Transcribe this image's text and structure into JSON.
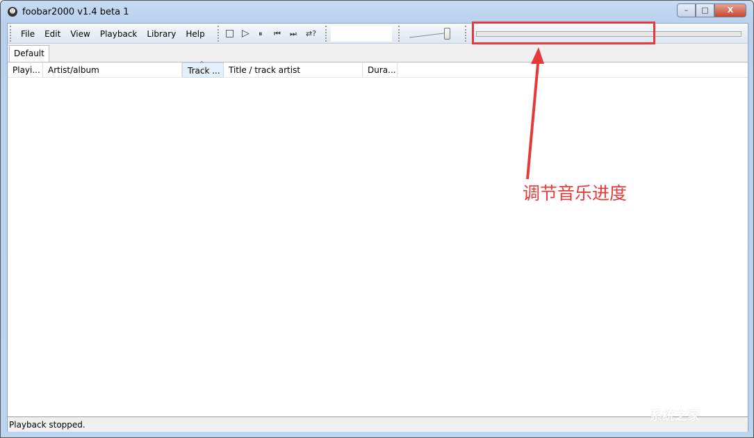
{
  "window": {
    "title": "foobar2000 v1.4 beta 1",
    "controls": {
      "minimize": "–",
      "maximize": "□",
      "close": "X"
    }
  },
  "menu": [
    "File",
    "Edit",
    "View",
    "Playback",
    "Library",
    "Help"
  ],
  "transport": {
    "stop": "□",
    "play": "▷",
    "pause": "⏸",
    "prev": "⏮",
    "next": "⏭",
    "random": "⇄?"
  },
  "volume": {
    "level": 0.9
  },
  "seekbar": {
    "position": 0
  },
  "tabs": [
    "Default"
  ],
  "columns": [
    "Playi...",
    "Artist/album",
    "Track ...",
    "Title / track artist",
    "Dura..."
  ],
  "status": "Playback stopped.",
  "annotation": {
    "text": "调节音乐进度",
    "color": "#e53a3a"
  },
  "watermark": "系统之家 XITONGZHIJIA.NET"
}
